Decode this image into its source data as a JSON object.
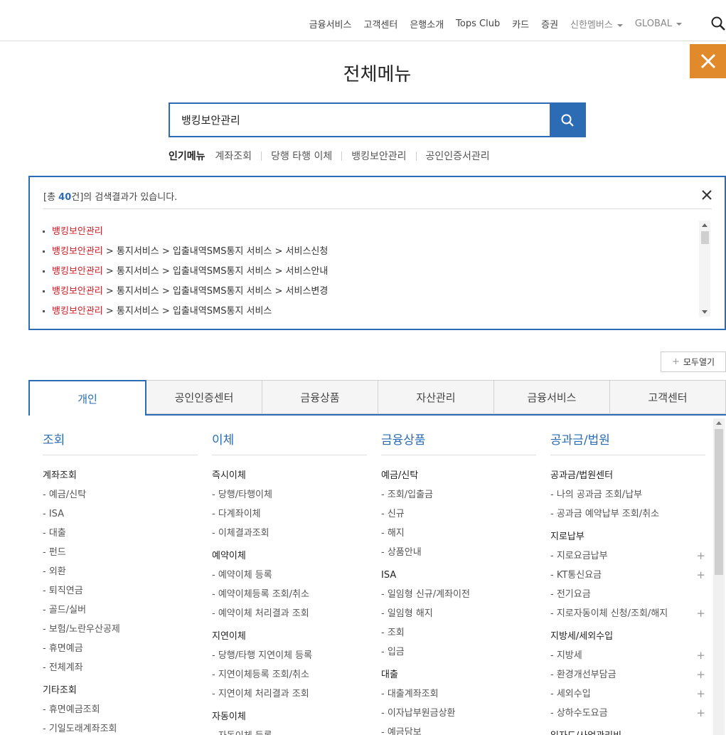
{
  "topnav": {
    "items": [
      "금융서비스",
      "고객센터",
      "은행소개",
      "Tops Club",
      "카드",
      "증권"
    ],
    "dropdowns": [
      "신한멤버스",
      "GLOBAL"
    ]
  },
  "page_title": "전체메뉴",
  "search": {
    "value": "뱅킹보안관리"
  },
  "popular": {
    "label": "인기메뉴",
    "items": [
      "계좌조회",
      "당행 타행 이체",
      "뱅킹보안관리",
      "공인인증서관리"
    ]
  },
  "results": {
    "prefix": "[총 ",
    "count": "40",
    "suffix": "건]의 검색결과가 있습니다.",
    "items": [
      {
        "hl": "뱅킹보안관리",
        "rest": ""
      },
      {
        "hl": "뱅킹보안관리",
        "rest": " > 통지서비스 > 입출내역SMS통지 서비스 > 서비스신청"
      },
      {
        "hl": "뱅킹보안관리",
        "rest": " > 통지서비스 > 입출내역SMS통지 서비스 > 서비스안내"
      },
      {
        "hl": "뱅킹보안관리",
        "rest": " > 통지서비스 > 입출내역SMS통지 서비스 > 서비스변경"
      },
      {
        "hl": "뱅킹보안관리",
        "rest": " > 통지서비스 > 입출내역SMS통지 서비스"
      }
    ]
  },
  "expand_all": "모두열기",
  "tabs": [
    "개인",
    "공인인증센터",
    "금융상품",
    "자산관리",
    "금융서비스",
    "고객센터"
  ],
  "columns": [
    {
      "title": "조회",
      "groups": [
        {
          "name": "계좌조회",
          "links": [
            "- 예금/신탁",
            "- ISA",
            "- 대출",
            "- 펀드",
            "- 외환",
            "- 퇴직연금",
            "- 골드/실버",
            "- 보험/노란우산공제",
            "- 휴면예금",
            "- 전체계좌"
          ]
        },
        {
          "name": "기타조회",
          "links": [
            "- 휴면예금조회",
            "- 기일도래계좌조회"
          ]
        }
      ]
    },
    {
      "title": "이체",
      "groups": [
        {
          "name": "즉시이체",
          "links": [
            "- 당행/타행이체",
            "- 다계좌이체",
            "- 이체결과조회"
          ]
        },
        {
          "name": "예약이체",
          "links": [
            "- 예약이체 등록",
            "- 예약이체등록 조회/취소",
            "- 예약이체 처리결과 조회"
          ]
        },
        {
          "name": "지연이체",
          "links": [
            "- 당행/타행 지연이체 등록",
            "- 지연이체등록 조회/취소",
            "- 지연이체 처리결과 조회"
          ]
        },
        {
          "name": "자동이체",
          "links": [
            "- 자동이체 등록"
          ]
        }
      ]
    },
    {
      "title": "금융상품",
      "groups": [
        {
          "name": "예금/신탁",
          "links": [
            "- 조회/입출금",
            "- 신규",
            "- 해지",
            "- 상품안내"
          ]
        },
        {
          "name": "ISA",
          "links": [
            "- 일임형 신규/계좌이전",
            "- 일임형 해지",
            "- 조회",
            "- 입금"
          ]
        },
        {
          "name": "대출",
          "links": [
            "- 대출계좌조회",
            "- 이자납부원금상환",
            "- 예금담보"
          ]
        }
      ]
    },
    {
      "title": "공과금/법원",
      "groups": [
        {
          "name": "공과금/법원센터",
          "links": [
            "- 나의 공과금 조회/납부",
            "- 공과금 예약납부 조회/취소"
          ]
        },
        {
          "name": "지로납부",
          "links": [
            "- 지로요금납부",
            "- KT통신요금",
            "- 전기요금",
            "- 지로자동이체 신청/조회/해지"
          ]
        },
        {
          "name": "지방세/세외수입",
          "links": [
            "- 지방세",
            "- 환경개선부담금",
            "- 세외수입",
            "- 상하수도요금"
          ]
        },
        {
          "name": "일자드/사업관리비",
          "links": []
        }
      ]
    }
  ],
  "plus_rows": {
    "3": [
      [
        1,
        0
      ],
      [
        1,
        1
      ],
      [
        1,
        3
      ],
      [
        2,
        0
      ],
      [
        2,
        1
      ],
      [
        2,
        2
      ],
      [
        2,
        3
      ]
    ]
  },
  "colors": {
    "accent": "#2b6cb4",
    "close_bg": "#e08a2b",
    "highlight": "#c8242b"
  }
}
